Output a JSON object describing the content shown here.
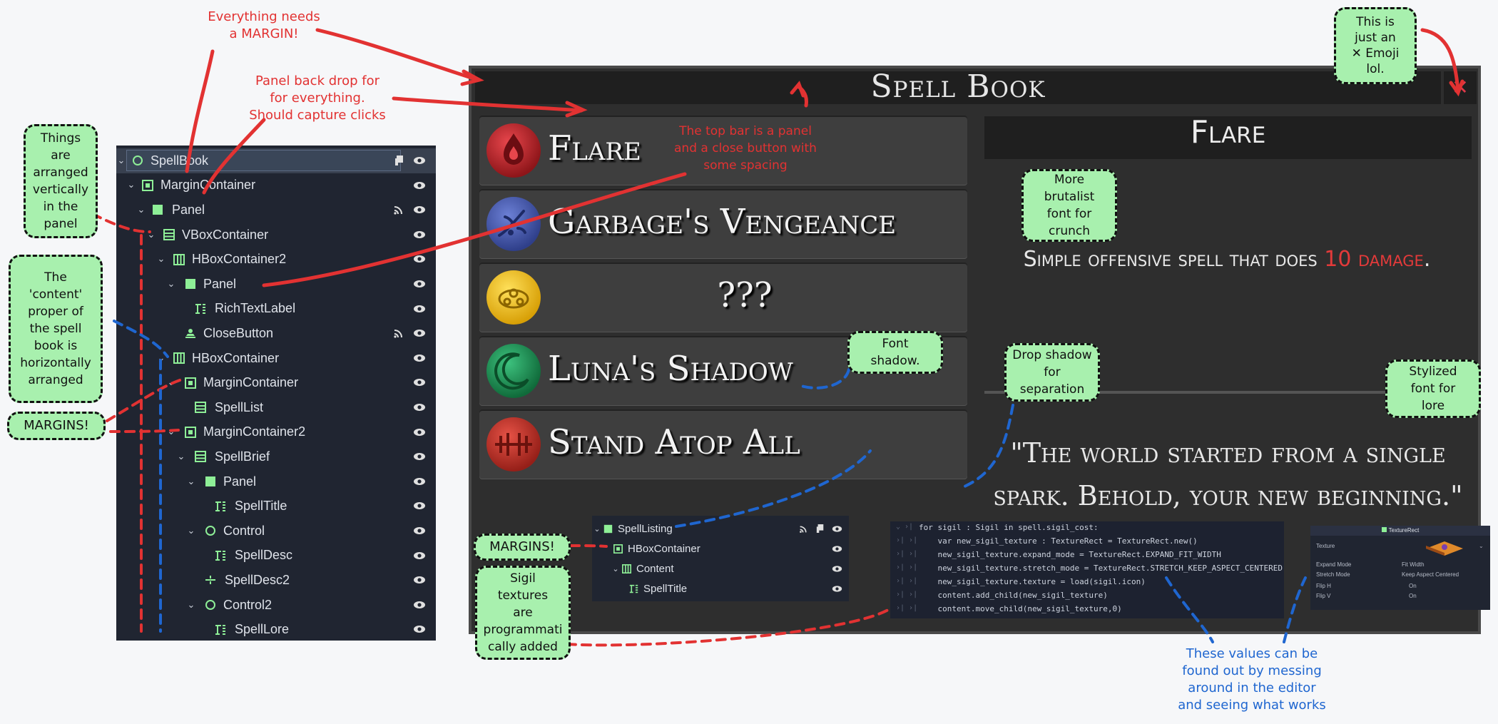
{
  "scene_tree": {
    "nodes": [
      {
        "label": "SpellBook",
        "icon": "control-node-icon"
      },
      {
        "label": "MarginContainer",
        "icon": "margin-container-icon"
      },
      {
        "label": "Panel",
        "icon": "panel-icon"
      },
      {
        "label": "VBoxContainer",
        "icon": "vbox-container-icon"
      },
      {
        "label": "HBoxContainer2",
        "icon": "hbox-container-icon"
      },
      {
        "label": "Panel",
        "icon": "panel-icon"
      },
      {
        "label": "RichTextLabel",
        "icon": "rich-text-label-icon"
      },
      {
        "label": "CloseButton",
        "icon": "texture-button-icon"
      },
      {
        "label": "HBoxContainer",
        "icon": "hbox-container-icon"
      },
      {
        "label": "MarginContainer",
        "icon": "margin-container-icon"
      },
      {
        "label": "SpellList",
        "icon": "vbox-container-icon"
      },
      {
        "label": "MarginContainer2",
        "icon": "margin-container-icon"
      },
      {
        "label": "SpellBrief",
        "icon": "vbox-container-icon"
      },
      {
        "label": "Panel",
        "icon": "panel-icon"
      },
      {
        "label": "SpellTitle",
        "icon": "rich-text-label-icon"
      },
      {
        "label": "Control",
        "icon": "control-node-icon"
      },
      {
        "label": "SpellDesc",
        "icon": "rich-text-label-icon"
      },
      {
        "label": "SpellDesc2",
        "icon": "separator-icon"
      },
      {
        "label": "Control2",
        "icon": "control-node-icon"
      },
      {
        "label": "SpellLore",
        "icon": "rich-text-label-icon"
      }
    ]
  },
  "spell_book": {
    "title": "Spell Book",
    "close_icon": "✕",
    "spells": [
      {
        "name": "Flare",
        "sigil_color": "#c0282e"
      },
      {
        "name": "Garbage's Vengeance",
        "sigil_color": "#4b5fb6"
      },
      {
        "name": "???",
        "sigil_color": "#f0c419"
      },
      {
        "name": "Luna's Shadow",
        "sigil_color": "#1f9a5b"
      },
      {
        "name": "Stand Atop All",
        "sigil_color": "#c8362e"
      }
    ],
    "brief": {
      "title": "Flare",
      "desc_main": "Simple offensive spell that does ",
      "desc_value": "10",
      "desc_tail": "damage",
      "desc_end": ".",
      "lore": "\"The world started from a single spark. Behold, your new beginning.\""
    }
  },
  "small_tree": {
    "nodes": [
      {
        "label": "SpellListing",
        "icon": "panel-icon"
      },
      {
        "label": "HBoxContainer",
        "icon": "margin-container-icon"
      },
      {
        "label": "Content",
        "icon": "hbox-container-icon"
      },
      {
        "label": "SpellTitle",
        "icon": "rich-text-label-icon"
      }
    ]
  },
  "code": {
    "lines": [
      "for sigil : Sigil in spell.sigil_cost:",
      "    var new_sigil_texture : TextureRect = TextureRect.new()",
      "    new_sigil_texture.expand_mode = TextureRect.EXPAND_FIT_WIDTH",
      "    new_sigil_texture.stretch_mode = TextureRect.STRETCH_KEEP_ASPECT_CENTERED",
      "    new_sigil_texture.texture = load(sigil.icon)",
      "    content.add_child(new_sigil_texture)",
      "    content.move_child(new_sigil_texture,0)"
    ]
  },
  "inspector": {
    "header": "TextureRect",
    "rows": [
      {
        "key": "Texture",
        "value": ""
      },
      {
        "key": "Expand Mode",
        "value": "Fit Width"
      },
      {
        "key": "Stretch Mode",
        "value": "Keep Aspect Centered"
      },
      {
        "key": "Flip H",
        "value": "On"
      },
      {
        "key": "Flip V",
        "value": "On"
      }
    ]
  },
  "annotations": {
    "margin": "Everything needs\na MARGIN!",
    "backdrop": "Panel back drop for\nfor everything.\nShould capture clicks",
    "topbar": "The top bar is a panel\nand a close button with\nsome spacing",
    "emoji": "This is\njust an\n✕ Emoji\nlol.",
    "vertical": "Things\nare\narranged\nvertically\nin the\npanel",
    "content": "The\n'content'\nproper of\nthe spell\nbook is\nhorizontally\narranged",
    "margins1": "MARGINS!",
    "margins2": "MARGINS!",
    "brutalist": "More\nbrutalist\nfont for\ncrunch",
    "font_shadow": "Font\nshadow.",
    "drop_shadow": "Drop shadow\nfor\nseparation",
    "stylized": "Stylized\nfont for\nlore",
    "sigil_textures": "Sigil\ntextures\nare\nprogrammati\ncally added",
    "editor_values": "These values can be\nfound out by messing\naround in the editor\nand seeing what works"
  },
  "colors": {
    "annotation_red": "#e23232",
    "annotation_blue": "#1f66d0",
    "bubble_green": "#a8f0ae",
    "damage_red": "#e33a3a"
  }
}
